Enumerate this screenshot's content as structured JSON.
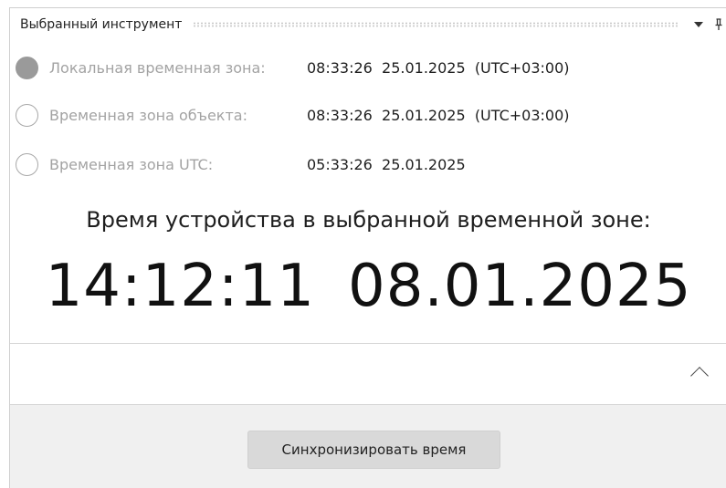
{
  "panel": {
    "title": "Выбранный инструмент"
  },
  "timezones": [
    {
      "label": "Локальная временная зона:",
      "time": "08:33:26",
      "date": "25.01.2025",
      "offset": "(UTC+03:00)",
      "selected": true
    },
    {
      "label": "Временная зона объекта:",
      "time": "08:33:26",
      "date": "25.01.2025",
      "offset": "(UTC+03:00)",
      "selected": false
    },
    {
      "label": "Временная зона UTC:",
      "time": "05:33:26",
      "date": "25.01.2025",
      "offset": "",
      "selected": false
    }
  ],
  "device": {
    "caption": "Время устройства в выбранной временной зоне:",
    "time": "14:12:11",
    "date": "08.01.2025"
  },
  "footer": {
    "sync_label": "Синхронизировать время"
  },
  "icons": {
    "dropdown": "triangle-down-icon",
    "pin": "pin-icon",
    "collapse": "chevron-up-icon"
  }
}
